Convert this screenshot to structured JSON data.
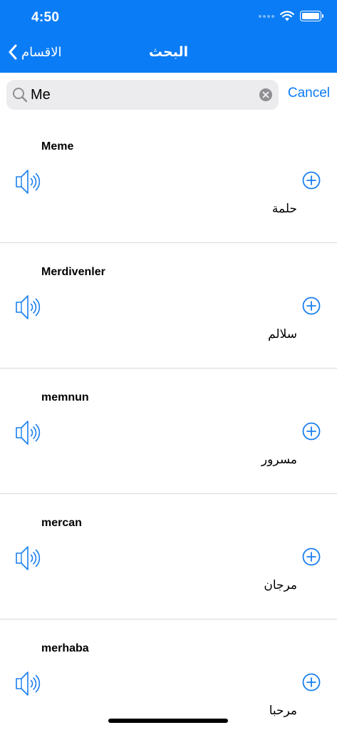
{
  "status_bar": {
    "time": "4:50"
  },
  "nav": {
    "back_label": "الاقسام",
    "title": "البحث"
  },
  "search": {
    "value": "Me",
    "cancel_label": "Cancel"
  },
  "results": [
    {
      "word": "Meme",
      "translation": "حلمة"
    },
    {
      "word": "Merdivenler",
      "translation": "سلالم"
    },
    {
      "word": "memnun",
      "translation": "مسرور"
    },
    {
      "word": "mercan",
      "translation": "مرجان"
    },
    {
      "word": "merhaba",
      "translation": "مرحبا"
    }
  ],
  "colors": {
    "accent": "#0a7cf5",
    "icon_blue": "#1a7ff0"
  }
}
